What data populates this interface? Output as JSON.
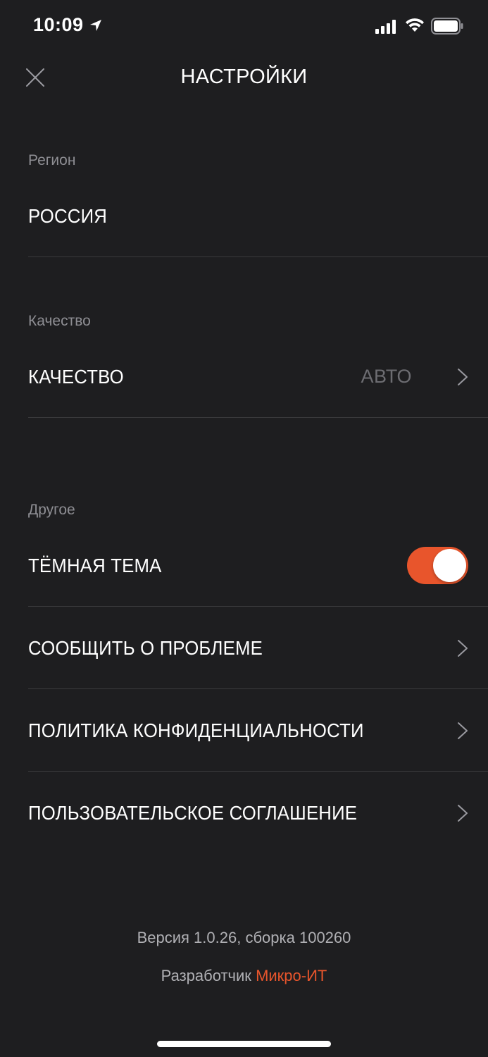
{
  "status_bar": {
    "time": "10:09",
    "location_icon": "location-arrow-icon",
    "signal_icon": "cellular-signal-icon",
    "wifi_icon": "wifi-icon",
    "battery_icon": "battery-icon"
  },
  "header": {
    "title": "НАСТРОЙКИ",
    "close_icon": "close-icon"
  },
  "sections": {
    "region": {
      "label": "Регион",
      "row_label": "РОССИЯ"
    },
    "quality": {
      "label": "Качество",
      "row_label": "КАЧЕСТВО",
      "row_value": "АВТО"
    },
    "other": {
      "label": "Другое",
      "dark_theme_label": "ТЁМНАЯ ТЕМА",
      "dark_theme_enabled": true,
      "report_label": "СООБЩИТЬ О ПРОБЛЕМЕ",
      "privacy_label": "ПОЛИТИКА КОНФИДЕНЦИАЛЬНОСТИ",
      "agreement_label": "ПОЛЬЗОВАТЕЛЬСКОЕ СОГЛАШЕНИЕ"
    }
  },
  "footer": {
    "version": "Версия 1.0.26, сборка 100260",
    "developer_prefix": "Разработчик",
    "developer_name": "Микро-ИТ"
  },
  "colors": {
    "background": "#1e1e20",
    "accent": "#e8552c",
    "secondary_text": "#8e8e93",
    "divider": "#3a3a3c"
  }
}
